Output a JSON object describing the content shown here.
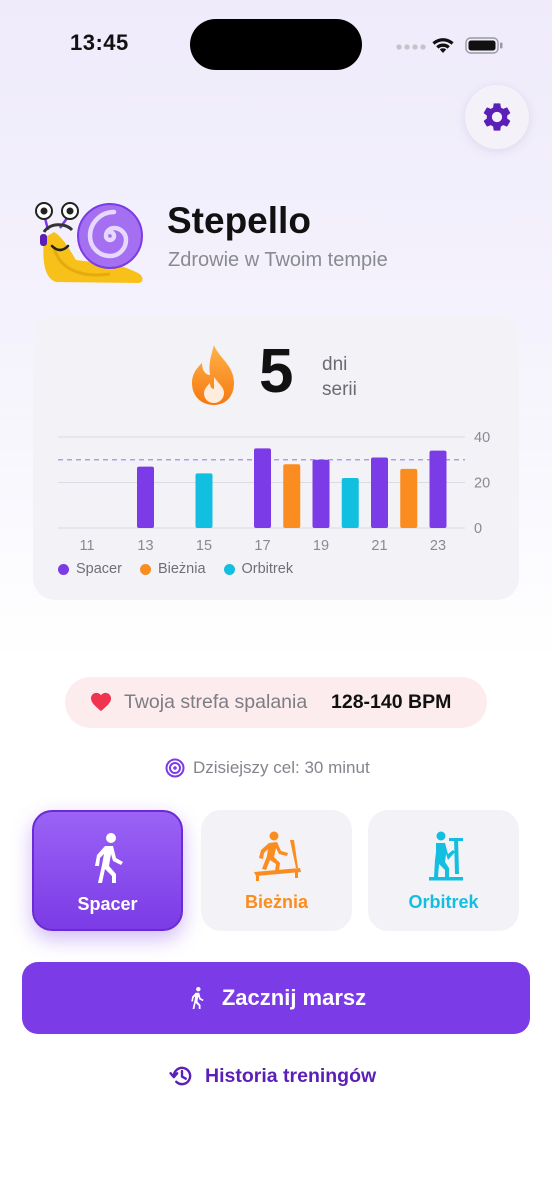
{
  "status": {
    "time": "13:45"
  },
  "app": {
    "title": "Stepello",
    "subtitle": "Zdrowie w Twoim tempie"
  },
  "streak": {
    "count": "5",
    "unit_line1": "dni",
    "unit_line2": "serii"
  },
  "chart_data": {
    "type": "bar",
    "x": [
      11,
      12,
      13,
      14,
      15,
      16,
      17,
      18,
      19,
      20,
      21,
      22,
      23
    ],
    "x_tick_labels": [
      "11",
      "13",
      "15",
      "17",
      "19",
      "21",
      "23"
    ],
    "series": [
      {
        "name": "Spacer",
        "color": "#7b3be6",
        "points": [
          [
            13,
            27
          ],
          [
            17,
            35
          ],
          [
            19,
            30
          ],
          [
            21,
            31
          ],
          [
            23,
            34
          ]
        ]
      },
      {
        "name": "Bieżnia",
        "color": "#fb8c1f",
        "points": [
          [
            18,
            28
          ],
          [
            22,
            26
          ]
        ]
      },
      {
        "name": "Orbitrek",
        "color": "#13bfe0",
        "points": [
          [
            15,
            24
          ],
          [
            20,
            22
          ]
        ]
      }
    ],
    "y_ticks": [
      "40",
      "20",
      "0"
    ],
    "ylim": [
      0,
      40
    ],
    "goal_line": 30,
    "grid": true,
    "legend_position": "bottom-left"
  },
  "legend": {
    "spacer": "Spacer",
    "bieznia": "Bieżnia",
    "orbitrek": "Orbitrek"
  },
  "zone": {
    "label": "Twoja strefa spalania",
    "value": "128-140 BPM"
  },
  "goal": {
    "text": "Dzisiejszy cel: 30 minut"
  },
  "activities": [
    {
      "label": "Spacer",
      "icon": "walking-person-icon",
      "selected": true
    },
    {
      "label": "Bieżnia",
      "icon": "treadmill-icon",
      "selected": false
    },
    {
      "label": "Orbitrek",
      "icon": "elliptical-icon",
      "selected": false
    }
  ],
  "start_button": {
    "label": "Zacznij marsz"
  },
  "history_link": {
    "label": "Historia treningów"
  },
  "colors": {
    "accent": "#7b3be6",
    "spacer": "#7b3be6",
    "bieznia": "#fb8c1f",
    "orbitrek": "#13bfe0",
    "heart": "#f0344f"
  }
}
